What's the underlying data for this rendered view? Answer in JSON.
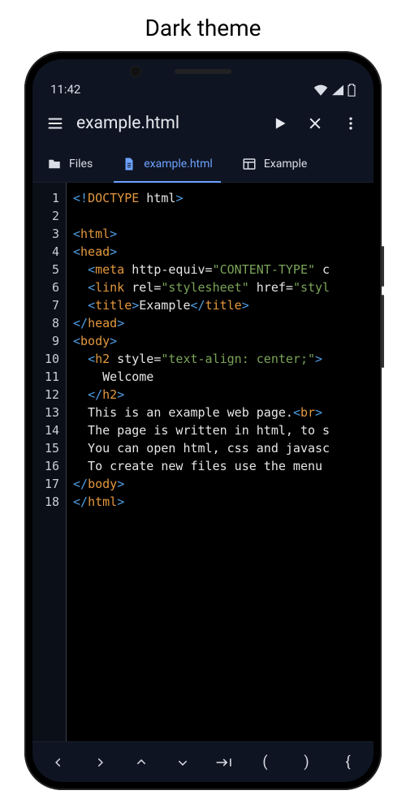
{
  "caption": "Dark theme",
  "status": {
    "time": "11:42"
  },
  "appbar": {
    "title": "example.html",
    "menu_icon": "menu",
    "play_icon": "play",
    "close_icon": "close",
    "more_icon": "more-vert"
  },
  "tabs": [
    {
      "id": "files",
      "label": "Files",
      "icon": "folder",
      "active": false
    },
    {
      "id": "example",
      "label": "example.html",
      "icon": "file",
      "active": true
    },
    {
      "id": "preview",
      "label": "Example",
      "icon": "preview",
      "active": false
    }
  ],
  "code": [
    {
      "n": 1,
      "tokens": [
        [
          "p",
          "<!"
        ],
        [
          "t",
          "DOCTYPE"
        ],
        [
          "a",
          " html"
        ],
        [
          "p",
          ">"
        ]
      ]
    },
    {
      "n": 2,
      "tokens": []
    },
    {
      "n": 3,
      "tokens": [
        [
          "p",
          "<"
        ],
        [
          "t",
          "html"
        ],
        [
          "p",
          ">"
        ]
      ]
    },
    {
      "n": 4,
      "tokens": [
        [
          "p",
          "<"
        ],
        [
          "t",
          "head"
        ],
        [
          "p",
          ">"
        ]
      ]
    },
    {
      "n": 5,
      "tokens": [
        [
          "tx",
          "  "
        ],
        [
          "p",
          "<"
        ],
        [
          "t",
          "meta"
        ],
        [
          "a",
          " http-equiv="
        ],
        [
          "s",
          "\"CONTENT-TYPE\""
        ],
        [
          "a",
          " c"
        ]
      ]
    },
    {
      "n": 6,
      "tokens": [
        [
          "tx",
          "  "
        ],
        [
          "p",
          "<"
        ],
        [
          "t",
          "link"
        ],
        [
          "a",
          " rel="
        ],
        [
          "s",
          "\"stylesheet\""
        ],
        [
          "a",
          " href="
        ],
        [
          "s",
          "\"styl"
        ]
      ]
    },
    {
      "n": 7,
      "tokens": [
        [
          "tx",
          "  "
        ],
        [
          "p",
          "<"
        ],
        [
          "t",
          "title"
        ],
        [
          "p",
          ">"
        ],
        [
          "tx",
          "Example"
        ],
        [
          "p",
          "</"
        ],
        [
          "t",
          "title"
        ],
        [
          "p",
          ">"
        ]
      ]
    },
    {
      "n": 8,
      "tokens": [
        [
          "p",
          "</"
        ],
        [
          "t",
          "head"
        ],
        [
          "p",
          ">"
        ]
      ]
    },
    {
      "n": 9,
      "tokens": [
        [
          "p",
          "<"
        ],
        [
          "t",
          "body"
        ],
        [
          "p",
          ">"
        ]
      ]
    },
    {
      "n": 10,
      "tokens": [
        [
          "tx",
          "  "
        ],
        [
          "p",
          "<"
        ],
        [
          "t",
          "h2"
        ],
        [
          "a",
          " style="
        ],
        [
          "s",
          "\"text-align: center;\""
        ],
        [
          "p",
          ">"
        ]
      ]
    },
    {
      "n": 11,
      "tokens": [
        [
          "tx",
          "    Welcome"
        ]
      ]
    },
    {
      "n": 12,
      "tokens": [
        [
          "tx",
          "  "
        ],
        [
          "p",
          "</"
        ],
        [
          "t",
          "h2"
        ],
        [
          "p",
          ">"
        ]
      ]
    },
    {
      "n": 13,
      "tokens": [
        [
          "tx",
          "  This is an example web page."
        ],
        [
          "p",
          "<"
        ],
        [
          "t",
          "br"
        ],
        [
          "p",
          ">"
        ]
      ]
    },
    {
      "n": 14,
      "tokens": [
        [
          "tx",
          "  The page is written in html, to s"
        ]
      ]
    },
    {
      "n": 15,
      "tokens": [
        [
          "tx",
          "  You can open html, css and javasc"
        ]
      ]
    },
    {
      "n": 16,
      "tokens": [
        [
          "tx",
          "  To create new files use the menu "
        ]
      ]
    },
    {
      "n": 17,
      "tokens": [
        [
          "p",
          "</"
        ],
        [
          "t",
          "body"
        ],
        [
          "p",
          ">"
        ]
      ]
    },
    {
      "n": 18,
      "tokens": [
        [
          "p",
          "</"
        ],
        [
          "t",
          "html"
        ],
        [
          "p",
          ">"
        ]
      ]
    }
  ],
  "bottom_keys": [
    {
      "id": "left",
      "glyph": "‹"
    },
    {
      "id": "right",
      "glyph": "›"
    },
    {
      "id": "up",
      "glyph": "˄"
    },
    {
      "id": "down",
      "glyph": "˅"
    },
    {
      "id": "tab",
      "glyph": "→|"
    },
    {
      "id": "lparen",
      "glyph": "("
    },
    {
      "id": "rparen",
      "glyph": ")"
    },
    {
      "id": "lbrace",
      "glyph": "{"
    }
  ]
}
